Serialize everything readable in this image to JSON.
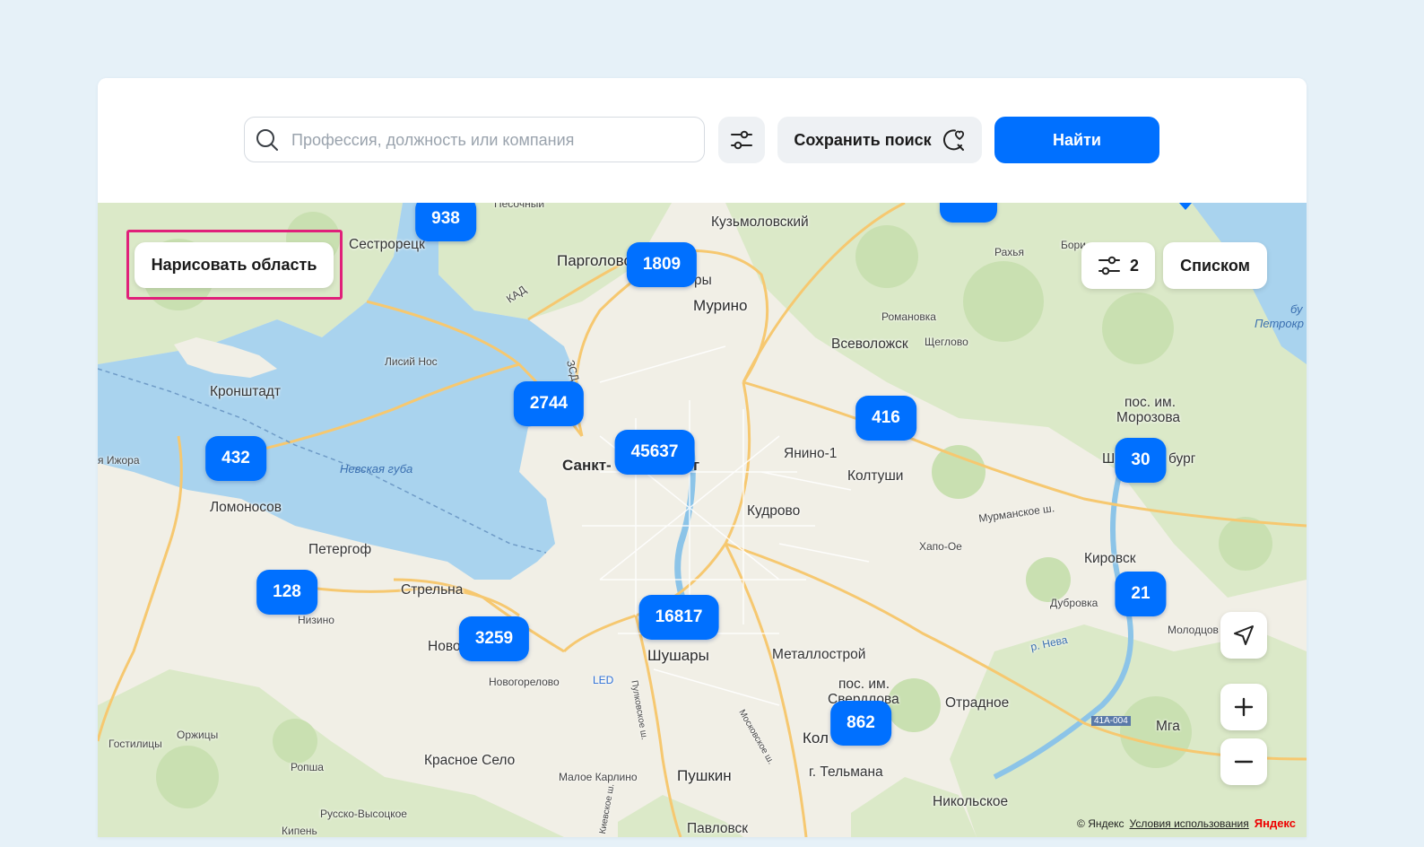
{
  "search": {
    "placeholder": "Профессия, должность или компания",
    "save_label": "Сохранить поиск",
    "find_label": "Найти"
  },
  "map": {
    "draw_area_label": "Нарисовать область",
    "filters_count": "2",
    "list_label": "Списком",
    "copyright": "© Яндекс",
    "terms_label": "Условия использования",
    "brand_label": "Яндекс",
    "clusters": [
      "938",
      "1809",
      "2744",
      "45637",
      "432",
      "416",
      "30",
      "128",
      "3259",
      "16817",
      "21",
      "862"
    ],
    "places": {
      "sestroretsk": "Сестрорецк",
      "pesochny": "Песочный",
      "kuzmolovsky": "Кузьмоловский",
      "pargolovo": "Парголово",
      "ry": "ры",
      "murino": "Мурино",
      "rakhya": "Рахья",
      "bori": "Бори",
      "romanovka": "Романовка",
      "vsevolozhsk": "Всеволожск",
      "shcheglovo": "Щеглово",
      "lisiy_nos": "Лисий Нос",
      "kronshtadt": "Кронштадт",
      "izhora": "я Ижора",
      "nevskaya_guba": "Невская губа",
      "sankt": "Санкт-",
      "g": "г",
      "yanino": "Янино-1",
      "koltushi": "Колтуши",
      "morozova": "пос. им.",
      "morozova2": "Морозова",
      "shl": "Ш",
      "burg": "бург",
      "lomonosov": "Ломоносов",
      "kudrovo": "Кудрово",
      "peterhof": "Петергоф",
      "khapo_oe": "Хапо-Ое",
      "kirovsk": "Кировск",
      "strelna": "Стрельна",
      "nizino": "Низино",
      "dubrovka": "Дубровка",
      "novo": "Ново",
      "shushary": "Шушары",
      "metallostroy": "Металлострой",
      "molodtsovo": "Молодцов",
      "novogorelovo": "Новогорелово",
      "led": "LED",
      "sverdlova": "пос. им.",
      "sverdlova2": "Свердлова",
      "otradnoe": "Отрадное",
      "gostilitsy": "Гостилицы",
      "orzhitsy": "Оржицы",
      "kol": "Кол",
      "mga": "Мга",
      "ropsha": "Ропша",
      "krasnoe_selo": "Красное Село",
      "maloe_karlino": "Малое Карлино",
      "pushkin": "Пушкин",
      "telmana": "г. Тельмана",
      "russko": "Русско-Высоцкое",
      "nikolskoe": "Никольское",
      "kipen": "Кипень",
      "pavlovsk": "Павловск",
      "bu": "бу",
      "petrokr": "Петрокр",
      "kad": "КАД",
      "zsd": "ЗСД",
      "murmanskoe": "Мурманское ш.",
      "p_neva": "р. Нева",
      "a41": "41А-004",
      "pulkovskoe": "Пулковское ш.",
      "moskovskoe": "Московское ш.",
      "kievskoe": "Киевское ш."
    }
  }
}
